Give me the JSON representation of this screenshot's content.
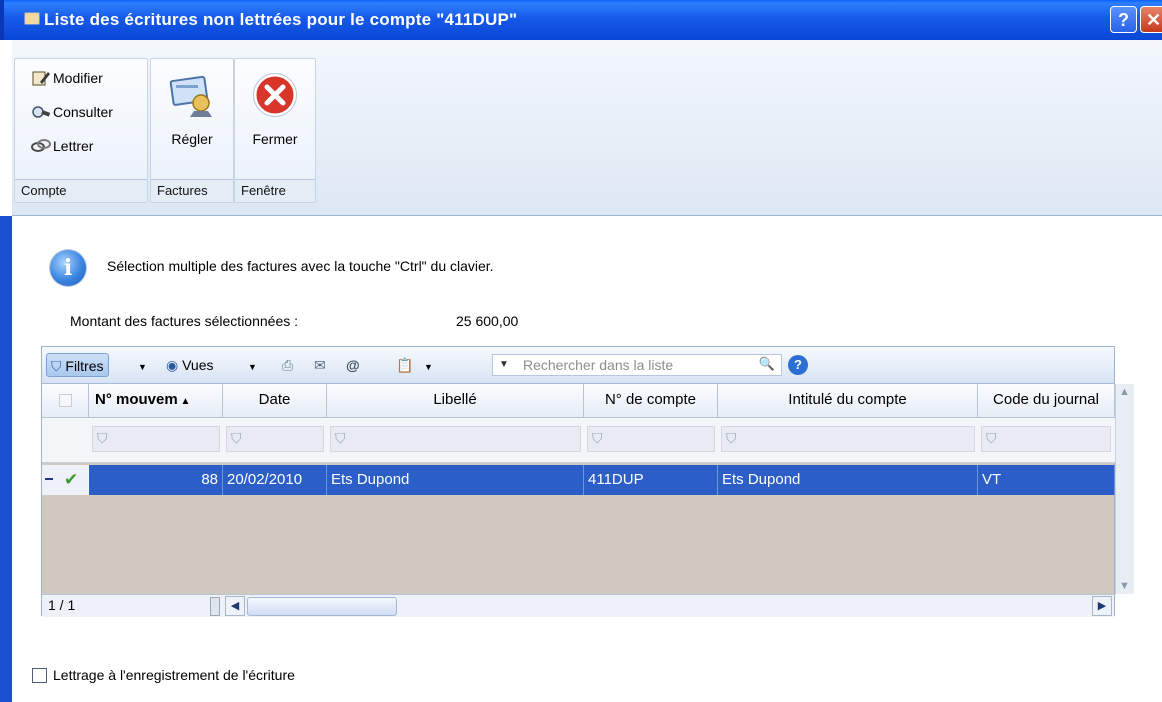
{
  "window": {
    "title": "Liste des écritures non lettrées pour le compte \"411DUP\"",
    "help_label": "?",
    "close_label": "✕"
  },
  "ribbon": {
    "compte_group": {
      "label": "Compte",
      "items": [
        {
          "label": "Modifier",
          "icon": "edit-icon"
        },
        {
          "label": "Consulter",
          "icon": "view-icon"
        },
        {
          "label": "Lettrer",
          "icon": "link-icon"
        }
      ]
    },
    "factures_group": {
      "label": "Factures",
      "regler_label": "Régler",
      "icon": "payment-icon"
    },
    "fenetre_group": {
      "label": "Fenêtre",
      "fermer_label": "Fermer",
      "icon": "close-circle-icon"
    }
  },
  "info": {
    "text": "Sélection multiple des factures avec la touche \"Ctrl\" du clavier.",
    "icon": "info-icon"
  },
  "amount": {
    "label": "Montant des factures sélectionnées :",
    "value": "25 600,00"
  },
  "grid_toolbar": {
    "filtres_label": "Filtres",
    "vues_label": "Vues",
    "search_placeholder": "Rechercher dans la liste",
    "help_label": "?"
  },
  "table": {
    "columns": [
      "N° mouvem",
      "Date",
      "Libellé",
      "N° de compte",
      "Intitulé du compte",
      "Code du journal"
    ],
    "rows": [
      {
        "numero": "88",
        "date": "20/02/2010",
        "libelle": "Ets Dupond",
        "compte": "411DUP",
        "intitule": "Ets Dupond",
        "journal": "VT",
        "checked": true
      }
    ],
    "pager": "1 / 1"
  },
  "footer": {
    "lettrage_label": "Lettrage à l'enregistrement de l'écriture"
  },
  "colors": {
    "titlebar": "#1659e8",
    "selected_row": "#2b5fc7",
    "ribbon_bg": "#e9f0f9"
  }
}
